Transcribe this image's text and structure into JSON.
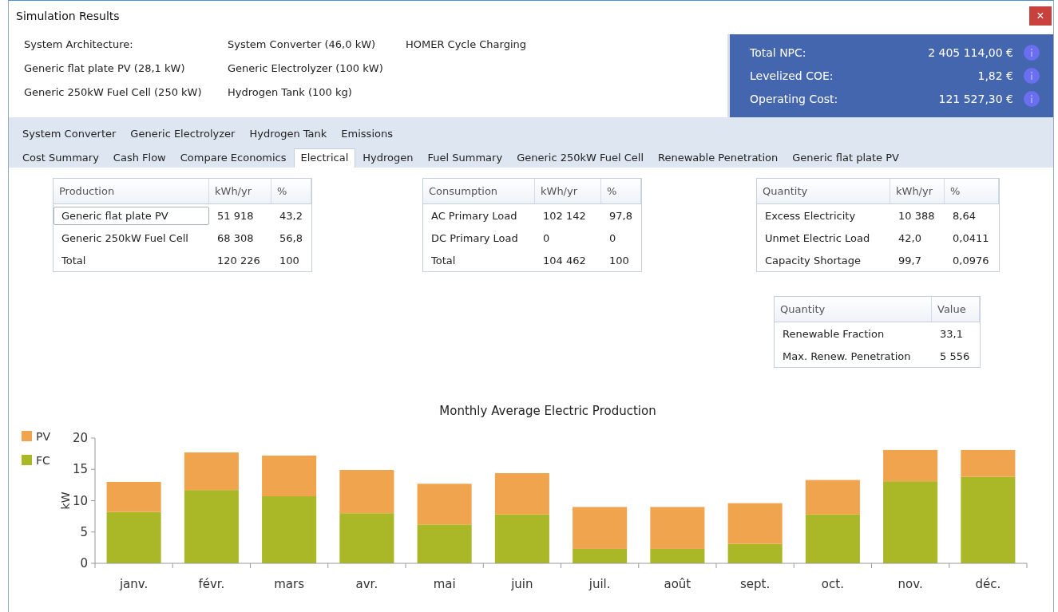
{
  "window": {
    "title": "Simulation Results",
    "close_label": "×"
  },
  "architecture": [
    [
      "System Architecture:",
      "System Converter (46,0 kW)",
      "HOMER Cycle Charging"
    ],
    [
      "Generic flat plate PV (28,1 kW)",
      "Generic Electrolyzer (100 kW)"
    ],
    [
      "Generic 250kW Fuel Cell (250 kW)",
      "Hydrogen Tank (100 kg)"
    ]
  ],
  "summary": [
    {
      "label": "Total NPC:",
      "value": "2 405 114,00 €"
    },
    {
      "label": "Levelized COE:",
      "value": "1,82 €"
    },
    {
      "label": "Operating Cost:",
      "value": "121 527,30 €"
    }
  ],
  "tab_rows": [
    [
      {
        "label": "System Converter",
        "selected": false
      },
      {
        "label": "Generic Electrolyzer",
        "selected": false
      },
      {
        "label": "Hydrogen Tank",
        "selected": false
      },
      {
        "label": "Emissions",
        "selected": false
      }
    ],
    [
      {
        "label": "Cost Summary",
        "selected": false
      },
      {
        "label": "Cash Flow",
        "selected": false
      },
      {
        "label": "Compare Economics",
        "selected": false
      },
      {
        "label": "Electrical",
        "selected": true
      },
      {
        "label": "Hydrogen",
        "selected": false
      },
      {
        "label": "Fuel Summary",
        "selected": false
      },
      {
        "label": "Generic 250kW Fuel Cell",
        "selected": false
      },
      {
        "label": "Renewable Penetration",
        "selected": false
      },
      {
        "label": "Generic flat plate PV",
        "selected": false
      }
    ]
  ],
  "tables": [
    {
      "columns": [
        "Production",
        "kWh/yr",
        "%"
      ],
      "rows": [
        {
          "cells": [
            "Generic flat plate PV",
            "51 918",
            "43,2"
          ],
          "selected": true
        },
        {
          "cells": [
            "Generic 250kW Fuel Cell",
            "68 308",
            "56,8"
          ],
          "selected": false
        },
        {
          "cells": [
            "Total",
            "120 226",
            "100"
          ],
          "selected": false
        }
      ]
    },
    {
      "columns": [
        "Consumption",
        "kWh/yr",
        "%"
      ],
      "rows": [
        {
          "cells": [
            "AC Primary Load",
            "102 142",
            "97,8"
          ],
          "selected": false
        },
        {
          "cells": [
            "DC Primary Load",
            "0",
            "0"
          ],
          "selected": false
        },
        {
          "cells": [
            "Total",
            "104 462",
            "100"
          ],
          "selected": false
        }
      ]
    },
    {
      "columns": [
        "Quantity",
        "kWh/yr",
        "%"
      ],
      "rows": [
        {
          "cells": [
            "Excess Electricity",
            "10 388",
            "8,64"
          ],
          "selected": false
        },
        {
          "cells": [
            "Unmet Electric Load",
            "42,0",
            "0,0411"
          ],
          "selected": false
        },
        {
          "cells": [
            "Capacity Shortage",
            "99,7",
            "0,0976"
          ],
          "selected": false
        }
      ]
    },
    {
      "columns": [
        "Quantity",
        "Value"
      ],
      "rows": [
        {
          "cells": [
            "Renewable Fraction",
            "33,1"
          ],
          "selected": false
        },
        {
          "cells": [
            "Max. Renew. Penetration",
            "5 556"
          ],
          "selected": false
        }
      ]
    }
  ],
  "chart": {
    "chart_data": {
      "type": "bar",
      "title": "Monthly Average Electric Production",
      "ylabel": "kW",
      "stacked": true,
      "categories": [
        "janv.",
        "févr.",
        "mars",
        "avr.",
        "mai",
        "juin",
        "juil.",
        "août",
        "sept.",
        "oct.",
        "nov.",
        "déc."
      ],
      "series": [
        {
          "name": "FC",
          "color": "#aab827",
          "values": [
            8.2,
            11.7,
            10.7,
            8.0,
            6.2,
            7.8,
            2.3,
            2.3,
            3.1,
            7.8,
            13.1,
            13.8
          ]
        },
        {
          "name": "PV",
          "color": "#f0a44e",
          "values": [
            4.8,
            6.0,
            6.5,
            6.9,
            6.5,
            6.6,
            6.7,
            6.7,
            6.5,
            5.5,
            5.0,
            4.3
          ]
        }
      ],
      "ylim": [
        0,
        20
      ],
      "yticks": [
        0,
        5,
        10,
        15,
        20
      ],
      "legend": true
    }
  }
}
